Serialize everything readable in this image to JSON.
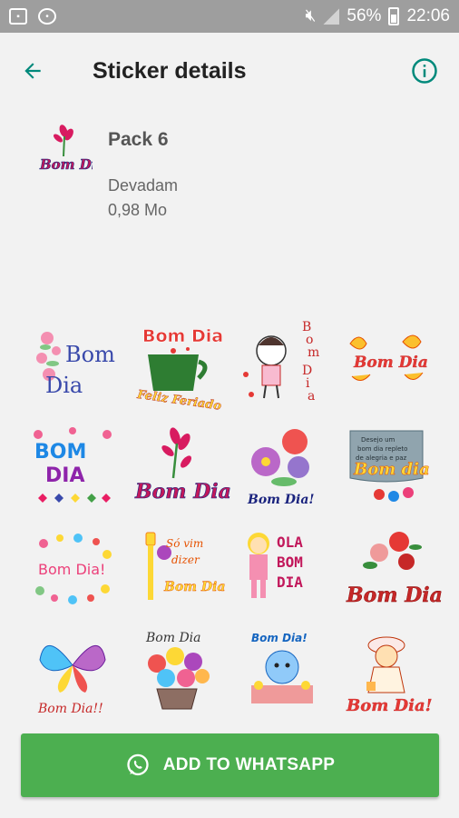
{
  "status_bar": {
    "battery": "56%",
    "time": "22:06"
  },
  "app_bar": {
    "title": "Sticker details"
  },
  "pack": {
    "name": "Pack 6",
    "author": "Devadam",
    "size": "0,98 Mo",
    "tray_text": "Bom Dia"
  },
  "stickers": [
    {
      "text": "Bom Dia",
      "sub": ""
    },
    {
      "text": "Bom Dia",
      "sub": "Feliz Feriado"
    },
    {
      "text": "Bom Dia",
      "sub": ""
    },
    {
      "text": "Bom Dia",
      "sub": ""
    },
    {
      "text": "BOM DIA",
      "sub": ""
    },
    {
      "text": "Bom Dia",
      "sub": ""
    },
    {
      "text": "Bom Dia!",
      "sub": ""
    },
    {
      "text": "Bom dia",
      "sub": ""
    },
    {
      "text": "Bom Dia!",
      "sub": ""
    },
    {
      "text": "Bom Dia",
      "sub": "Só vim dizer"
    },
    {
      "text": "OLA BOM DIA",
      "sub": ""
    },
    {
      "text": "Bom Dia",
      "sub": ""
    },
    {
      "text": "Bom Dia!!",
      "sub": ""
    },
    {
      "text": "Bom Dia",
      "sub": ""
    },
    {
      "text": "Bom Dia!",
      "sub": ""
    },
    {
      "text": "Bom Dia!",
      "sub": ""
    }
  ],
  "add_button": {
    "label": "ADD TO WHATSAPP"
  },
  "colors": {
    "accent": "#00897b",
    "button": "#4caf50"
  }
}
